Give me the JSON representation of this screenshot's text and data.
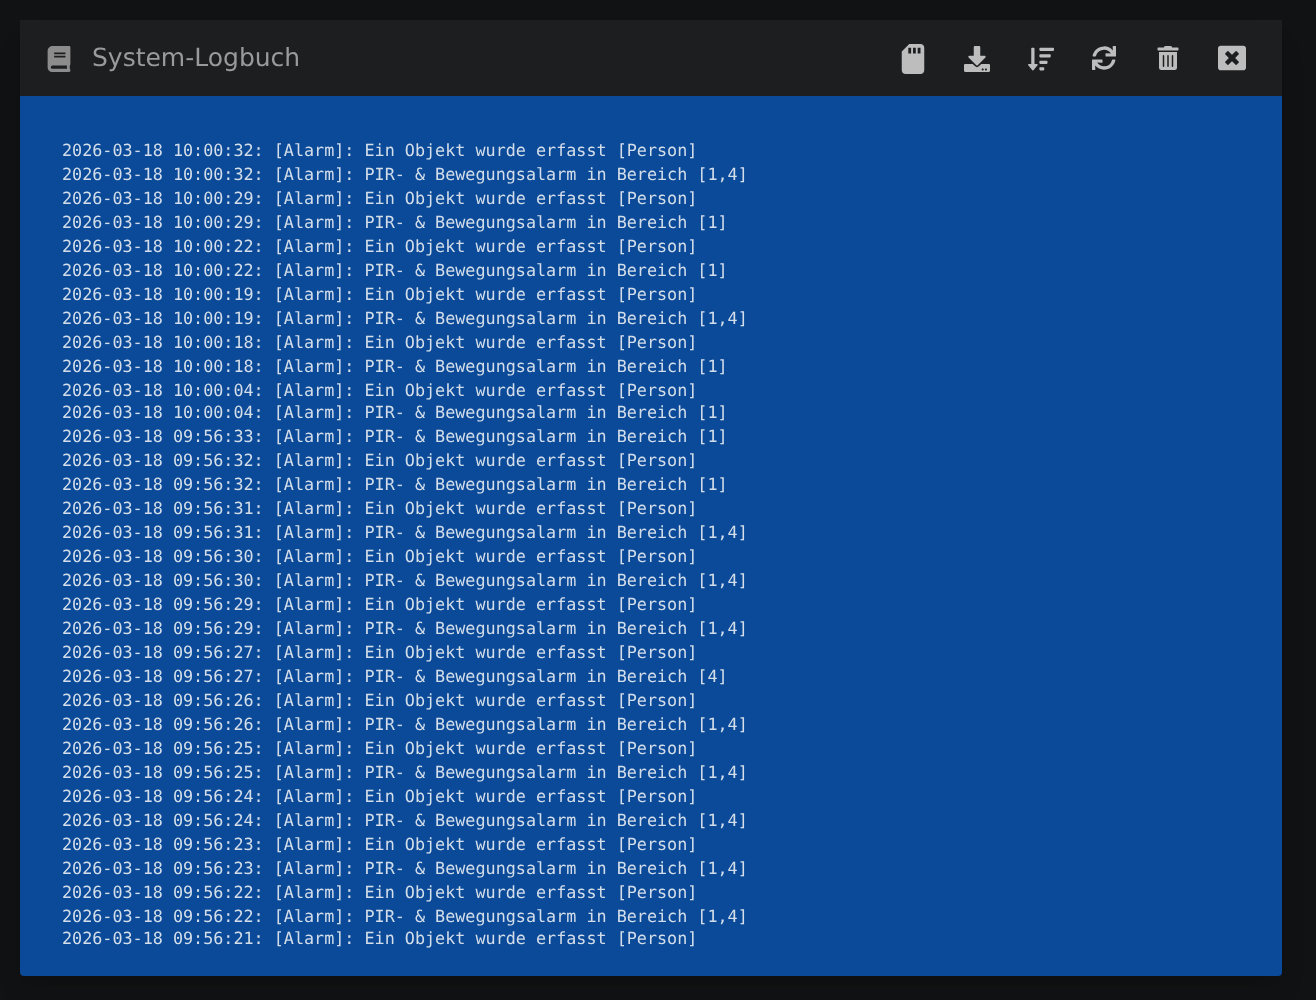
{
  "window": {
    "title": "System-Logbuch"
  },
  "log_lines": [
    "2026-03-18 10:00:32: [Alarm]: Ein Objekt wurde erfasst [Person]",
    "2026-03-18 10:00:32: [Alarm]: PIR- & Bewegungsalarm in Bereich [1,4]",
    "2026-03-18 10:00:29: [Alarm]: Ein Objekt wurde erfasst [Person]",
    "2026-03-18 10:00:29: [Alarm]: PIR- & Bewegungsalarm in Bereich [1]",
    "2026-03-18 10:00:22: [Alarm]: Ein Objekt wurde erfasst [Person]",
    "2026-03-18 10:00:22: [Alarm]: PIR- & Bewegungsalarm in Bereich [1]",
    "2026-03-18 10:00:19: [Alarm]: Ein Objekt wurde erfasst [Person]",
    "2026-03-18 10:00:19: [Alarm]: PIR- & Bewegungsalarm in Bereich [1,4]",
    "2026-03-18 10:00:18: [Alarm]: Ein Objekt wurde erfasst [Person]",
    "2026-03-18 10:00:18: [Alarm]: PIR- & Bewegungsalarm in Bereich [1]",
    "2026-03-18 10:00:04: [Alarm]: Ein Objekt wurde erfasst [Person]",
    "2026-03-18 10:00:04: [Alarm]: PIR- & Bewegungsalarm in Bereich [1]",
    "2026-03-18 09:56:33: [Alarm]: PIR- & Bewegungsalarm in Bereich [1]",
    "2026-03-18 09:56:32: [Alarm]: Ein Objekt wurde erfasst [Person]",
    "2026-03-18 09:56:32: [Alarm]: PIR- & Bewegungsalarm in Bereich [1]",
    "2026-03-18 09:56:31: [Alarm]: Ein Objekt wurde erfasst [Person]",
    "2026-03-18 09:56:31: [Alarm]: PIR- & Bewegungsalarm in Bereich [1,4]",
    "2026-03-18 09:56:30: [Alarm]: Ein Objekt wurde erfasst [Person]",
    "2026-03-18 09:56:30: [Alarm]: PIR- & Bewegungsalarm in Bereich [1,4]",
    "2026-03-18 09:56:29: [Alarm]: Ein Objekt wurde erfasst [Person]",
    "2026-03-18 09:56:29: [Alarm]: PIR- & Bewegungsalarm in Bereich [1,4]",
    "2026-03-18 09:56:27: [Alarm]: Ein Objekt wurde erfasst [Person]",
    "2026-03-18 09:56:27: [Alarm]: PIR- & Bewegungsalarm in Bereich [4]",
    "2026-03-18 09:56:26: [Alarm]: Ein Objekt wurde erfasst [Person]",
    "2026-03-18 09:56:26: [Alarm]: PIR- & Bewegungsalarm in Bereich [1,4]",
    "2026-03-18 09:56:25: [Alarm]: Ein Objekt wurde erfasst [Person]",
    "2026-03-18 09:56:25: [Alarm]: PIR- & Bewegungsalarm in Bereich [1,4]",
    "2026-03-18 09:56:24: [Alarm]: Ein Objekt wurde erfasst [Person]",
    "2026-03-18 09:56:24: [Alarm]: PIR- & Bewegungsalarm in Bereich [1,4]",
    "2026-03-18 09:56:23: [Alarm]: Ein Objekt wurde erfasst [Person]",
    "2026-03-18 09:56:23: [Alarm]: PIR- & Bewegungsalarm in Bereich [1,4]",
    "2026-03-18 09:56:22: [Alarm]: Ein Objekt wurde erfasst [Person]",
    "2026-03-18 09:56:22: [Alarm]: PIR- & Bewegungsalarm in Bereich [1,4]",
    "2026-03-18 09:56:21: [Alarm]: Ein Objekt wurde erfasst [Person]"
  ]
}
